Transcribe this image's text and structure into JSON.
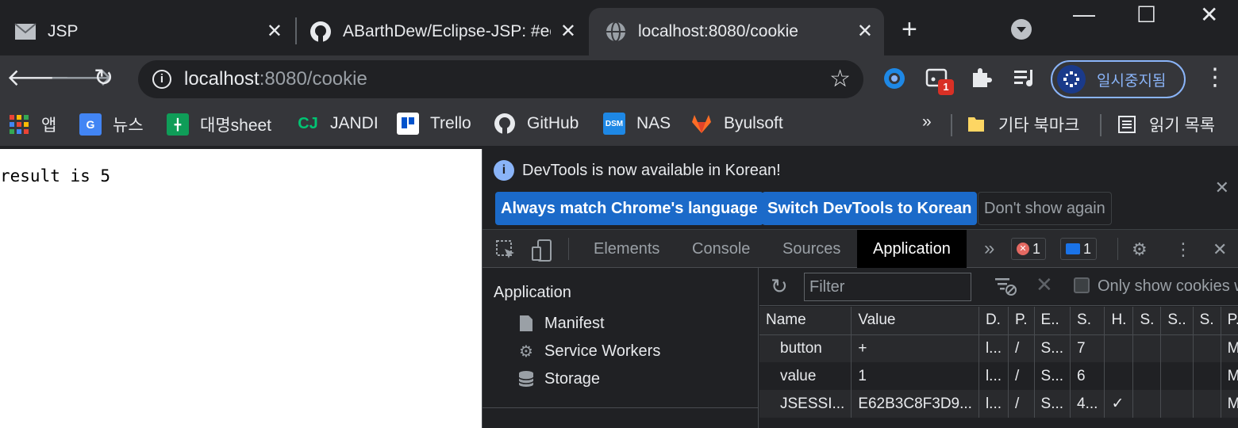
{
  "tabs": [
    {
      "title": "JSP",
      "icon": "mail-icon"
    },
    {
      "title": "ABarthDew/Eclipse-JSP: #ec",
      "icon": "github-icon"
    },
    {
      "title": "localhost:8080/cookie",
      "icon": "globe-icon",
      "active": true
    }
  ],
  "window": {
    "minimize": "—",
    "maximize": "☐",
    "close": "✕"
  },
  "toolbar": {
    "url_host": "localhost",
    "url_rest": ":8080/cookie",
    "ext_badge": "1",
    "profile_label": "일시중지됨"
  },
  "bookmarks": [
    {
      "label": "앱",
      "icon": "apps-icon"
    },
    {
      "label": "뉴스",
      "icon": "google-news-icon"
    },
    {
      "label": "대명sheet",
      "icon": "sheets-icon"
    },
    {
      "label": "JANDI",
      "icon": "jandi-icon"
    },
    {
      "label": "Trello",
      "icon": "trello-icon"
    },
    {
      "label": "GitHub",
      "icon": "github-icon"
    },
    {
      "label": "NAS",
      "icon": "dsm-icon"
    },
    {
      "label": "Byulsoft",
      "icon": "gitlab-icon"
    }
  ],
  "bookmarks_right": {
    "overflow": "»",
    "other": "기타 북마크",
    "reading": "읽기 목록"
  },
  "page": {
    "result": "result is 5"
  },
  "devtools": {
    "infobar": {
      "message": "DevTools is now available in Korean!",
      "btn_match": "Always match Chrome's language",
      "btn_switch": "Switch DevTools to Korean",
      "btn_dont": "Don't show again"
    },
    "tabs": [
      "Elements",
      "Console",
      "Sources",
      "Application"
    ],
    "active_tab": "Application",
    "more": "»",
    "errors": "1",
    "messages": "1",
    "sidebar": {
      "heading": "Application",
      "items": [
        "Manifest",
        "Service Workers",
        "Storage"
      ]
    },
    "cookies": {
      "filter_placeholder": "Filter",
      "only_show_label": "Only show cookies w",
      "columns": [
        "Name",
        "Value",
        "D.",
        "P.",
        "E..",
        "S.",
        "H.",
        "S.",
        "S..",
        "S.",
        "P.."
      ],
      "rows": [
        [
          "button",
          "+",
          "l...",
          "/",
          "S...",
          "7",
          "",
          "",
          "",
          "",
          "M.."
        ],
        [
          "value",
          "1",
          "l...",
          "/",
          "S...",
          "6",
          "",
          "",
          "",
          "",
          "M.."
        ],
        [
          "JSESSI...",
          "E62B3C8F3D9...",
          "l...",
          "/",
          "S...",
          "4...",
          "✓",
          "",
          "",
          "",
          "M.."
        ]
      ]
    }
  }
}
